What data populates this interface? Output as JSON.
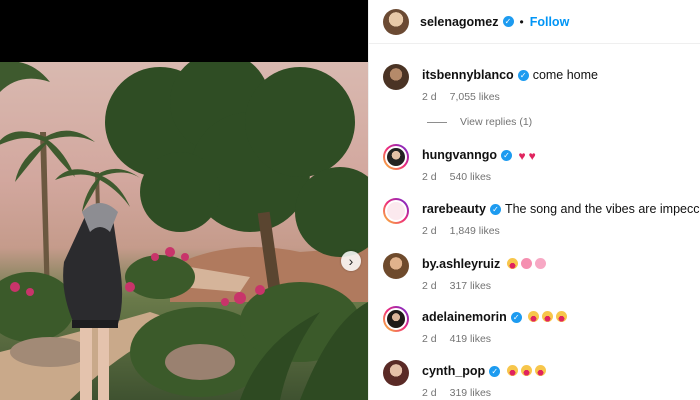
{
  "post": {
    "author": "selenagomez",
    "separator": "•",
    "follow_label": "Follow",
    "next_glyph": "›"
  },
  "comments": [
    {
      "user": "itsbennyblanco",
      "verified": true,
      "text": "come home",
      "emojis": [],
      "age": "2 d",
      "likes": "7,055 likes"
    },
    {
      "user": "hungvanngo",
      "verified": true,
      "text": "",
      "emojis": [
        "heart",
        "heart"
      ],
      "age": "2 d",
      "likes": "540 likes"
    },
    {
      "user": "rarebeauty",
      "verified": true,
      "text": "The song and the vibes are impeccable",
      "emojis": [
        "face"
      ],
      "age": "2 d",
      "likes": "1,849 likes"
    },
    {
      "user": "by.ashleyruiz",
      "verified": false,
      "text": "",
      "emojis": [
        "face",
        "face",
        "face"
      ],
      "age": "2 d",
      "likes": "317 likes"
    },
    {
      "user": "adelainemorin",
      "verified": true,
      "text": "",
      "emojis": [
        "face",
        "face",
        "face"
      ],
      "age": "2 d",
      "likes": "419 likes"
    },
    {
      "user": "cynth_pop",
      "verified": true,
      "text": "",
      "emojis": [
        "face",
        "face",
        "face"
      ],
      "age": "2 d",
      "likes": "319 likes"
    }
  ],
  "view_replies_label": "View replies (1)",
  "colors": {
    "accent": "#0095f6",
    "verified": "#1d9bf0",
    "muted": "#737373"
  },
  "icons": {
    "next": "chevron-right-icon",
    "verified": "verified-badge-icon"
  }
}
